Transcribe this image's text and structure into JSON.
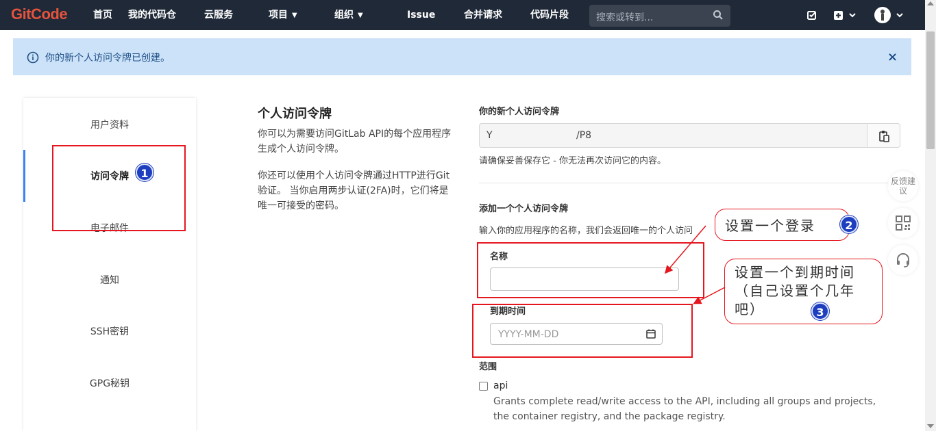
{
  "nav": {
    "logo": "GitCode",
    "items": [
      {
        "label": "首页"
      },
      {
        "label": "我的代码仓"
      },
      {
        "label": "云服务"
      },
      {
        "label": "项目",
        "chevron": "▼"
      },
      {
        "label": "组织",
        "chevron": "▼"
      },
      {
        "label": "Issue"
      },
      {
        "label": "合并请求"
      },
      {
        "label": "代码片段"
      }
    ],
    "search_placeholder": "搜索或转到...",
    "icons": [
      "search-icon",
      "todo-icon",
      "plus-icon",
      "avatar"
    ]
  },
  "alert": {
    "text": "你的新个人访问令牌已创建。",
    "close": "×",
    "color": "#cbe2f9"
  },
  "sidebar": {
    "items": [
      {
        "label": "用户资料"
      },
      {
        "label": "访问令牌",
        "active": true
      },
      {
        "label": "电子邮件"
      },
      {
        "label": "通知"
      },
      {
        "label": "SSH密钥"
      },
      {
        "label": "GPG秘钥"
      }
    ]
  },
  "intro": {
    "title": "个人访问令牌",
    "p1": "你可以为需要访问GitLab API的每个应用程序生成个人访问令牌。",
    "p2": "你还可以使用个人访问令牌通过HTTP进行Git验证。 当你启用两步认证(2FA)时，它们将是唯一可接受的密码。"
  },
  "token": {
    "label": "你的新个人访问令牌",
    "value_start": "Y",
    "value_end": "/P8",
    "warning": "请确保妥善保存它 - 你无法再次访问它的内容。"
  },
  "form": {
    "heading": "添加一个个人访问令牌",
    "description": "输入你的应用程序的名称，我们会返回唯一的个人访问",
    "name_label": "名称",
    "name_value": "",
    "expiry_label": "到期时间",
    "expiry_placeholder": "YYYY-MM-DD",
    "scopes_label": "范围",
    "scopes": [
      {
        "name": "api",
        "description": "Grants complete read/write access to the API, including all groups and projects, the container registry, and the package registry."
      }
    ]
  },
  "float_widgets": [
    {
      "label": "反馈建议"
    },
    {
      "icon": "qrcode-icon"
    },
    {
      "icon": "headset-icon"
    }
  ],
  "annotations": {
    "badges": [
      "1",
      "2",
      "3"
    ],
    "callout_login": "设置一个登录",
    "callout_expiry": "设置一个到期时间（自己设置个几年吧）"
  },
  "colors": {
    "nav_bg": "#1f2937",
    "logo": "#e5533d",
    "annotation_red": "#e5161d",
    "badge_blue": "#1d3fbf",
    "active_bar": "#3b82f6"
  }
}
